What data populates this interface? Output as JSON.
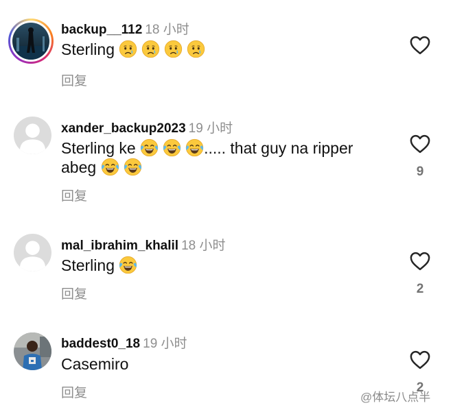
{
  "comments": [
    {
      "username": "backup__112",
      "time": "18 小时",
      "text": "Sterling",
      "emojis": [
        "crying-face",
        "crying-face",
        "crying-face",
        "crying-face"
      ],
      "reply_label": "回复",
      "likes": ""
    },
    {
      "username": "xander_backup2023",
      "time": "19 小时",
      "text_part1": "Sterling ke",
      "text_part2": "..... that guy na ripper",
      "text_part3": "abeg",
      "emojis": [
        "tears-of-joy",
        "tears-of-joy",
        "tears-of-joy",
        "tears-of-joy",
        "tears-of-joy"
      ],
      "reply_label": "回复",
      "likes": "9"
    },
    {
      "username": "mal_ibrahim_khalil",
      "time": "18 小时",
      "text": "Sterling",
      "emojis": [
        "tears-of-joy"
      ],
      "reply_label": "回复",
      "likes": "2"
    },
    {
      "username": "baddest0_18",
      "time": "19 小时",
      "text": "Casemiro",
      "emojis": [],
      "reply_label": "回复",
      "likes": "2"
    }
  ],
  "watermark": "@体坛八点半",
  "colors": {
    "secondary_text": "#8e8e8e",
    "heart_stroke": "#262626",
    "default_avatar": "#dcdcdc"
  },
  "icons": [
    "heart-outline-icon",
    "crying-face-emoji",
    "tears-of-joy-emoji",
    "default-avatar-icon"
  ]
}
